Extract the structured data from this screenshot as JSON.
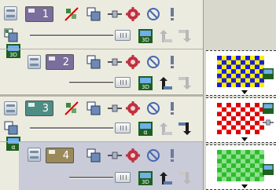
{
  "layers": [
    {
      "name": "1",
      "color": "#7a6e9c"
    },
    {
      "name": "2",
      "color": "#7a6e9c"
    },
    {
      "name": "3",
      "color": "#4e8d84"
    },
    {
      "name": "4",
      "color": "#9a8a5a"
    }
  ],
  "thumbnails": [
    {
      "colors": [
        "#1d1dd8",
        "#f5f000"
      ]
    },
    {
      "colors": [
        "#e00000",
        "#ffffff"
      ]
    },
    {
      "colors": [
        "#2fba2f",
        "#8ee28e"
      ]
    }
  ],
  "icons": {
    "info": "!",
    "ban": "⊘"
  },
  "badges": {
    "threeD": "3D",
    "alpha": "α"
  }
}
